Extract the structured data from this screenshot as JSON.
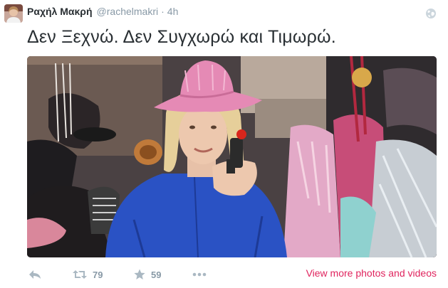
{
  "tweet": {
    "author_name": "Ραχήλ Μακρή",
    "handle": "@rachelmakri",
    "separator": "·",
    "time": "4h",
    "text": "Δεν Ξεχνώ. Δεν Συγχωρώ και Τιμωρώ."
  },
  "actions": {
    "reply_icon": "reply-icon",
    "retweet_icon": "retweet-icon",
    "retweet_count": "79",
    "favorite_icon": "star-icon",
    "favorite_count": "59",
    "more_icon": "more-dots-icon",
    "view_more": "View more photos and videos"
  },
  "colors": {
    "link": "#e0245e",
    "muted": "#8899a6",
    "icon": "#aab8c2",
    "text": "#292f33"
  }
}
